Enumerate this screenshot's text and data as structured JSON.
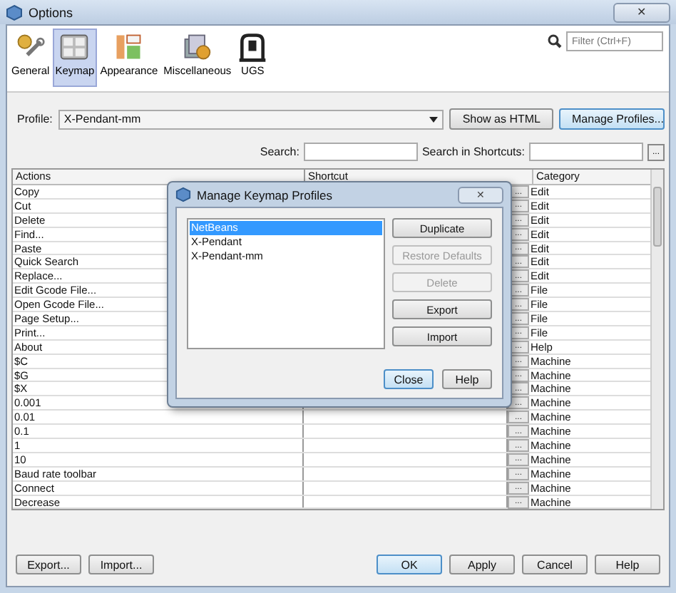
{
  "window": {
    "title": "Options",
    "close": "✕"
  },
  "filter": {
    "placeholder": "Filter (Ctrl+F)"
  },
  "categories": [
    {
      "label": "General",
      "kind": "general",
      "selected": false
    },
    {
      "label": "Keymap",
      "kind": "keymap",
      "selected": true
    },
    {
      "label": "Appearance",
      "kind": "appearance",
      "selected": false
    },
    {
      "label": "Miscellaneous",
      "kind": "misc",
      "selected": false
    },
    {
      "label": "UGS",
      "kind": "ugs",
      "selected": false
    }
  ],
  "profile": {
    "label": "Profile:",
    "value": "X-Pendant-mm",
    "show_html": "Show as HTML",
    "manage": "Manage Profiles..."
  },
  "search": {
    "label": "Search:",
    "shortcuts_label": "Search in Shortcuts:",
    "browse": "..."
  },
  "table": {
    "columns": [
      "Actions",
      "Shortcut",
      "Category"
    ],
    "rows": [
      {
        "action": "Copy",
        "category": "Edit",
        "button": "..."
      },
      {
        "action": "Cut",
        "category": "Edit",
        "button": "..."
      },
      {
        "action": "Delete",
        "category": "Edit",
        "button": "..."
      },
      {
        "action": "Find...",
        "category": "Edit",
        "button": "..."
      },
      {
        "action": "Paste",
        "category": "Edit",
        "button": "..."
      },
      {
        "action": "Quick Search",
        "category": "Edit",
        "button": "..."
      },
      {
        "action": "Replace...",
        "category": "Edit",
        "button": "..."
      },
      {
        "action": "Edit Gcode File...",
        "category": "File",
        "button": "..."
      },
      {
        "action": "Open Gcode File...",
        "category": "File",
        "button": "..."
      },
      {
        "action": "Page Setup...",
        "category": "File",
        "button": "..."
      },
      {
        "action": "Print...",
        "category": "File",
        "button": "..."
      },
      {
        "action": "About",
        "category": "Help",
        "button": "..."
      },
      {
        "action": "$C",
        "category": "Machine",
        "button": "..."
      },
      {
        "action": "$G",
        "category": "Machine",
        "button": "..."
      },
      {
        "action": "$X",
        "category": "Machine",
        "button": "..."
      },
      {
        "action": "0.001",
        "category": "Machine",
        "button": "..."
      },
      {
        "action": "0.01",
        "category": "Machine",
        "button": "..."
      },
      {
        "action": "0.1",
        "category": "Machine",
        "button": "..."
      },
      {
        "action": "1",
        "category": "Machine",
        "button": "..."
      },
      {
        "action": "10",
        "category": "Machine",
        "button": "..."
      },
      {
        "action": "Baud rate toolbar",
        "category": "Machine",
        "button": "..."
      },
      {
        "action": "Connect",
        "category": "Machine",
        "button": "..."
      },
      {
        "action": "Decrease",
        "category": "Machine",
        "button": "..."
      }
    ]
  },
  "bottom_buttons": {
    "left": [
      "Export...",
      "Import..."
    ],
    "right": [
      {
        "label": "OK",
        "default": true
      },
      {
        "label": "Apply",
        "default": false
      },
      {
        "label": "Cancel",
        "default": false
      },
      {
        "label": "Help",
        "default": false
      }
    ]
  },
  "dialog": {
    "title": "Manage Keymap Profiles",
    "close": "✕",
    "profiles": [
      {
        "label": "NetBeans",
        "selected": true
      },
      {
        "label": "X-Pendant",
        "selected": false
      },
      {
        "label": "X-Pendant-mm",
        "selected": false
      }
    ],
    "actions": [
      {
        "label": "Duplicate",
        "disabled": false
      },
      {
        "label": "Restore Defaults",
        "disabled": true
      },
      {
        "label": "Delete",
        "disabled": true
      },
      {
        "label": "Export",
        "disabled": false
      },
      {
        "label": "Import",
        "disabled": false
      }
    ],
    "buttons": [
      {
        "label": "Close",
        "default": true
      },
      {
        "label": "Help",
        "default": false
      }
    ]
  }
}
